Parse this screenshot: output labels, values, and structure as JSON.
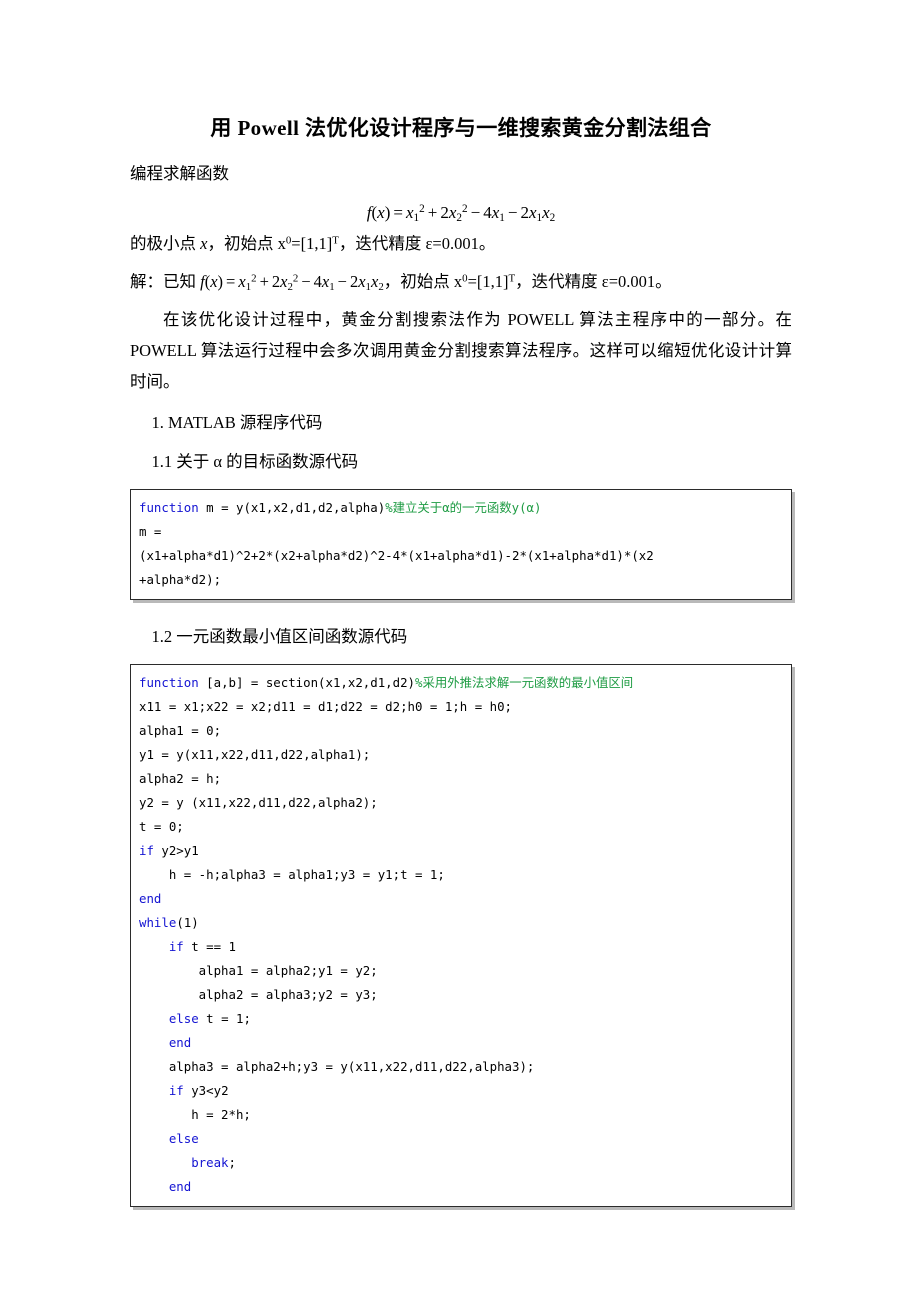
{
  "document": {
    "title": "用 Powell 法优化设计程序与一维搜索黄金分割法组合",
    "intro_line": "编程求解函数",
    "equation_display": "f(x) = x₁² + 2x₂² − 4x₁ − 2x₁x₂",
    "line_after_equation": "的极小点 x，初始点 x⁰=[1,1]ᵀ，迭代精度 ε=0.001。",
    "solution_line": "解：已知 f(x) = x₁² + 2x₂² − 4x₁ − 2x₁x₂，初始点 x⁰=[1,1]ᵀ，迭代精度 ε=0.001。",
    "body_paragraph": "在该优化设计过程中，黄金分割搜索法作为 POWELL 算法主程序中的一部分。在 POWELL 算法运行过程中会多次调用黄金分割搜索算法程序。这样可以缩短优化设计计算时间。",
    "heading_1": "1. MATLAB 源程序代码",
    "heading_1_1": "1.1  关于 α 的目标函数源代码",
    "heading_1_2": "1.2  一元函数最小值区间函数源代码"
  },
  "equation_parts": {
    "fx": "f",
    "open": "(",
    "x": "x",
    "close": ")",
    "eq": "=",
    "term1_base": "x",
    "term1_sub": "1",
    "term1_sup": "2",
    "plus": "+",
    "term2_coef": "2",
    "term2_base": "x",
    "term2_sub": "2",
    "term2_sup": "2",
    "minus1": "−",
    "term3_coef": "4",
    "term3_base": "x",
    "term3_sub": "1",
    "minus2": "−",
    "term4_coef": "2",
    "term4_base1": "x",
    "term4_sub1": "1",
    "term4_base2": "x",
    "term4_sub2": "2"
  },
  "inline_text": {
    "after_eq_prefix": "的极小点 ",
    "after_eq_x": "x",
    "after_eq_mid": "，初始点 x",
    "after_eq_sup0": "0",
    "after_eq_bracket": "=[1,1]",
    "after_eq_supT": "T",
    "after_eq_tail": "，迭代精度 ε=0.001。",
    "sol_prefix": "解：已知 ",
    "sol_mid": "，初始点 x",
    "sol_sup0": "0",
    "sol_bracket": "=[1,1]",
    "sol_supT": "T",
    "sol_tail": "，迭代精度 ε=0.001。"
  },
  "code_block_1": {
    "language": "matlab",
    "lines": [
      [
        {
          "t": "function",
          "c": "kw"
        },
        {
          "t": " m = y(x1,x2,d1,d2,alpha)",
          "c": "plain"
        },
        {
          "t": "%建立关于α的一元函数y(α)",
          "c": "cmt"
        }
      ],
      [
        {
          "t": "m =",
          "c": "plain"
        }
      ],
      [
        {
          "t": "(x1+alpha*d1)^2+2*(x2+alpha*d2)^2-4*(x1+alpha*d1)-2*(x1+alpha*d1)*(x2",
          "c": "plain"
        }
      ],
      [
        {
          "t": "+alpha*d2);",
          "c": "plain"
        }
      ]
    ]
  },
  "code_block_2": {
    "language": "matlab",
    "lines": [
      [
        {
          "t": "function",
          "c": "kw"
        },
        {
          "t": " [a,b] = section(x1,x2,d1,d2)",
          "c": "plain"
        },
        {
          "t": "%采用外推法求解一元函数的最小值区间",
          "c": "cmt"
        }
      ],
      [
        {
          "t": "x11 = x1;x22 = x2;d11 = d1;d22 = d2;h0 = 1;h = h0;",
          "c": "plain"
        }
      ],
      [
        {
          "t": "alpha1 = 0;",
          "c": "plain"
        }
      ],
      [
        {
          "t": "y1 = y(x11,x22,d11,d22,alpha1);",
          "c": "plain"
        }
      ],
      [
        {
          "t": "alpha2 = h;",
          "c": "plain"
        }
      ],
      [
        {
          "t": "y2 = y (x11,x22,d11,d22,alpha2);",
          "c": "plain"
        }
      ],
      [
        {
          "t": "t = 0;",
          "c": "plain"
        }
      ],
      [
        {
          "t": "if",
          "c": "kw"
        },
        {
          "t": " y2>y1",
          "c": "plain"
        }
      ],
      [
        {
          "t": "    h = -h;alpha3 = alpha1;y3 = y1;t = 1;",
          "c": "plain"
        }
      ],
      [
        {
          "t": "end",
          "c": "kw"
        }
      ],
      [
        {
          "t": "while",
          "c": "kw"
        },
        {
          "t": "(1)",
          "c": "plain"
        }
      ],
      [
        {
          "t": "    ",
          "c": "plain"
        },
        {
          "t": "if",
          "c": "kw"
        },
        {
          "t": " t == 1",
          "c": "plain"
        }
      ],
      [
        {
          "t": "        alpha1 = alpha2;y1 = y2;",
          "c": "plain"
        }
      ],
      [
        {
          "t": "        alpha2 = alpha3;y2 = y3;",
          "c": "plain"
        }
      ],
      [
        {
          "t": "    ",
          "c": "plain"
        },
        {
          "t": "else",
          "c": "kw"
        },
        {
          "t": " t = 1;",
          "c": "plain"
        }
      ],
      [
        {
          "t": "    ",
          "c": "plain"
        },
        {
          "t": "end",
          "c": "kw"
        }
      ],
      [
        {
          "t": "    alpha3 = alpha2+h;y3 = y(x11,x22,d11,d22,alpha3);",
          "c": "plain"
        }
      ],
      [
        {
          "t": "    ",
          "c": "plain"
        },
        {
          "t": "if",
          "c": "kw"
        },
        {
          "t": " y3<y2",
          "c": "plain"
        }
      ],
      [
        {
          "t": "       h = 2*h;",
          "c": "plain"
        }
      ],
      [
        {
          "t": "    ",
          "c": "plain"
        },
        {
          "t": "else",
          "c": "kw"
        }
      ],
      [
        {
          "t": "       ",
          "c": "plain"
        },
        {
          "t": "break",
          "c": "kw"
        },
        {
          "t": ";",
          "c": "plain"
        }
      ],
      [
        {
          "t": "    ",
          "c": "plain"
        },
        {
          "t": "end",
          "c": "kw"
        }
      ]
    ]
  },
  "colors": {
    "keyword": "#1414d2",
    "comment": "#1f9c44",
    "text": "#000000",
    "code_border": "#2b2b2b",
    "code_shadow": "#b9b9b9",
    "page_background": "#ffffff"
  }
}
